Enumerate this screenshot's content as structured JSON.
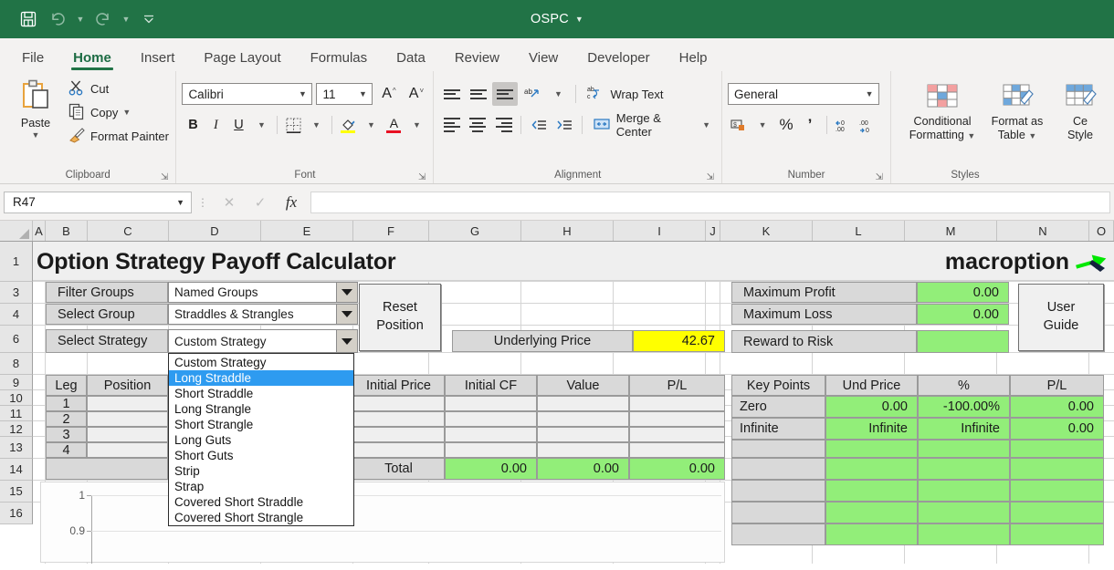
{
  "titlebar": {
    "document_name": "OSPC",
    "qat": [
      {
        "name": "save-icon",
        "label": "Save"
      },
      {
        "name": "undo-icon",
        "label": "Undo"
      },
      {
        "name": "redo-icon",
        "label": "Redo"
      },
      {
        "name": "customize-quick-access-toolbar-icon",
        "label": "Customize Quick Access Toolbar"
      }
    ]
  },
  "tabs": [
    {
      "label": "File",
      "active": false
    },
    {
      "label": "Home",
      "active": true
    },
    {
      "label": "Insert",
      "active": false
    },
    {
      "label": "Page Layout",
      "active": false
    },
    {
      "label": "Formulas",
      "active": false
    },
    {
      "label": "Data",
      "active": false
    },
    {
      "label": "Review",
      "active": false
    },
    {
      "label": "View",
      "active": false
    },
    {
      "label": "Developer",
      "active": false
    },
    {
      "label": "Help",
      "active": false
    }
  ],
  "ribbon": {
    "clipboard": {
      "group_label": "Clipboard",
      "paste_label": "Paste",
      "cut_label": "Cut",
      "copy_label": "Copy",
      "format_painter_label": "Format Painter"
    },
    "font": {
      "group_label": "Font",
      "font_name": "Calibri",
      "font_size": "11",
      "grow_font_label": "A",
      "shrink_font_label": "A",
      "bold_label": "B",
      "italic_label": "I",
      "underline_label": "U"
    },
    "alignment": {
      "group_label": "Alignment",
      "wrap_text_label": "Wrap Text",
      "merge_center_label": "Merge & Center"
    },
    "number": {
      "group_label": "Number",
      "format": "General",
      "percent_label": "%",
      "comma_label": "‰"
    },
    "styles": {
      "group_label": "Styles",
      "conditional_formatting_label": "Conditional\nFormatting",
      "conditional_formatting_line1": "Conditional",
      "conditional_formatting_line2": "Formatting",
      "format_as_table_line1": "Format as",
      "format_as_table_line2": "Table",
      "cell_styles_line1": "Ce",
      "cell_styles_line2": "Style"
    }
  },
  "formula_bar": {
    "name_box": "R47",
    "cancel_label": "✕",
    "enter_label": "✓",
    "insert_function_label": "fx",
    "formula_value": ""
  },
  "grid": {
    "columns": [
      "A",
      "B",
      "C",
      "D",
      "E",
      "F",
      "G",
      "H",
      "I",
      "J",
      "K",
      "L",
      "M",
      "N",
      "O"
    ],
    "rows": [
      "1",
      "3",
      "4",
      "6",
      "8",
      "9",
      "10",
      "11",
      "12",
      "13",
      "14",
      "15",
      "16"
    ]
  },
  "sheet": {
    "title": "Option Strategy Payoff Calculator",
    "brand": "macroption",
    "filter_groups_label": "Filter Groups",
    "filter_groups_value": "Named Groups",
    "select_group_label": "Select Group",
    "select_group_value": "Straddles & Strangles",
    "select_strategy_label": "Select Strategy",
    "select_strategy_value": "Custom Strategy",
    "reset_position_line1": "Reset",
    "reset_position_line2": "Position",
    "underlying_price_label": "Underlying Price",
    "underlying_price_value": "42.67",
    "user_guide_line1": "User",
    "user_guide_line2": "Guide",
    "maximum_profit_label": "Maximum Profit",
    "maximum_profit_value": "0.00",
    "maximum_loss_label": "Maximum Loss",
    "maximum_loss_value": "0.00",
    "reward_to_risk_label": "Reward to Risk",
    "reward_to_risk_value": "",
    "legs_table": {
      "headers": [
        "Leg",
        "Position",
        "Initial Price",
        "Initial CF",
        "Value",
        "P/L"
      ],
      "rows": [
        {
          "leg": "1",
          "position": "",
          "initial_price": "",
          "initial_cf": "",
          "value": "",
          "pl": ""
        },
        {
          "leg": "2",
          "position": "",
          "initial_price": "",
          "initial_cf": "",
          "value": "",
          "pl": ""
        },
        {
          "leg": "3",
          "position": "",
          "initial_price": "",
          "initial_cf": "",
          "value": "",
          "pl": ""
        },
        {
          "leg": "4",
          "position": "",
          "initial_price": "",
          "initial_cf": "",
          "value": "",
          "pl": ""
        }
      ],
      "total_label": "Total",
      "total_initial_cf": "0.00",
      "total_value": "0.00",
      "total_pl": "0.00"
    },
    "key_points_table": {
      "headers": [
        "Key Points",
        "Und Price",
        "%",
        "P/L"
      ],
      "rows": [
        {
          "name": "Zero",
          "und_price": "0.00",
          "pct": "-100.00%",
          "pl": "0.00"
        },
        {
          "name": "Infinite",
          "und_price": "Infinite",
          "pct": "Infinite",
          "pl": "0.00"
        }
      ]
    },
    "strategy_dropdown": {
      "open": true,
      "selected": "Long Straddle",
      "options": [
        "Custom Strategy",
        "Long Straddle",
        "Short Straddle",
        "Long Strangle",
        "Short Strangle",
        "Long Guts",
        "Short Guts",
        "Strip",
        "Strap",
        "Covered Short Straddle",
        "Covered Short Strangle"
      ]
    }
  },
  "chart_data": {
    "type": "line",
    "title": "",
    "xlabel": "",
    "ylabel": "",
    "x": [],
    "values": [],
    "yticks": [
      "1",
      "0.9"
    ],
    "ylim": [
      0.9,
      1
    ],
    "grid": true,
    "legend": "none"
  },
  "colors": {
    "ribbon_accent": "#217346",
    "highlight_green": "#92ee79",
    "highlight_yellow": "#ffff00",
    "label_gray": "#d9d9d9",
    "selection_blue": "#2e9bf0"
  }
}
